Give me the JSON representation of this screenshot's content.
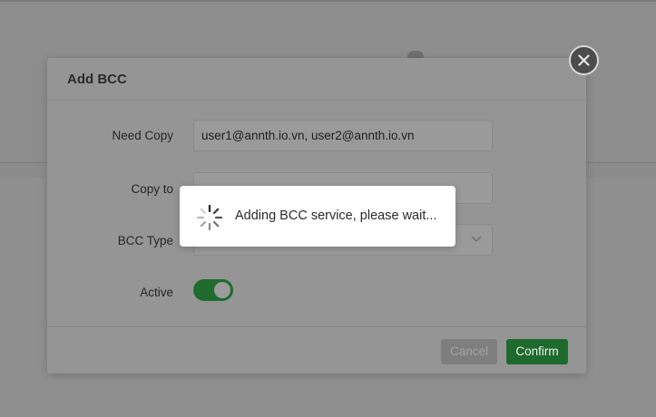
{
  "modal": {
    "title": "Add BCC",
    "fields": {
      "need_copy_label": "Need Copy",
      "need_copy_value": "user1@annth.io.vn, user2@annth.io.vn",
      "copy_to_label": "Copy to",
      "copy_to_value": "",
      "bcc_type_label": "BCC Type",
      "bcc_type_value": "",
      "active_label": "Active",
      "active_on": true
    },
    "buttons": {
      "cancel": "Cancel",
      "confirm": "Confirm"
    },
    "close_icon": "close-icon"
  },
  "loading": {
    "message": "Adding BCC service, please wait...",
    "icon": "spinner-icon"
  },
  "colors": {
    "accent_green": "#1d6a2c",
    "overlay": "#8d8d8d",
    "popup_bg": "#ffffff"
  }
}
